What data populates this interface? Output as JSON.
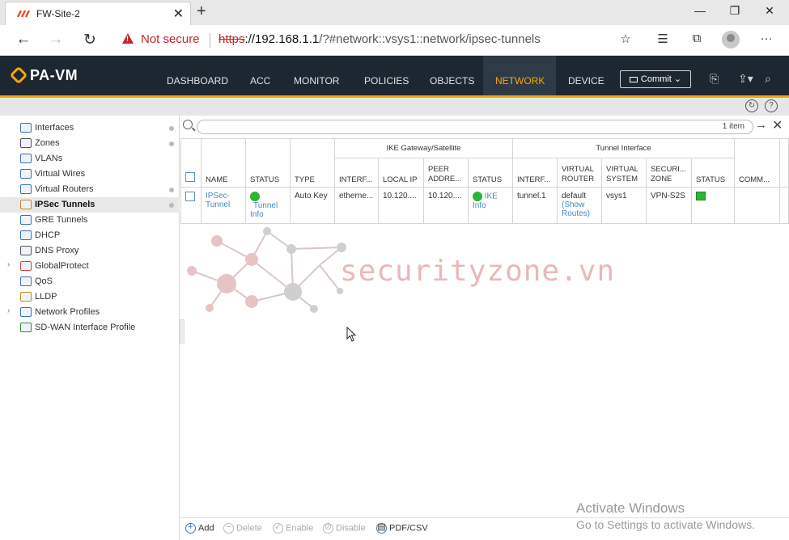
{
  "browser": {
    "tab_title": "FW-Site-2",
    "security_label": "Not secure",
    "url_scheme": "https",
    "url_host": "://192.168.1.1",
    "url_path": "/?#network::vsys1::network/ipsec-tunnels"
  },
  "app": {
    "brand": "PA-VM",
    "nav": [
      "DASHBOARD",
      "ACC",
      "MONITOR",
      "POLICIES",
      "OBJECTS",
      "NETWORK",
      "DEVICE"
    ],
    "active_nav": "NETWORK",
    "commit_label": "Commit"
  },
  "sidebar": {
    "items": [
      {
        "label": "Interfaces",
        "icon": "interfaces-icon",
        "dot": true
      },
      {
        "label": "Zones",
        "icon": "zones-icon",
        "dot": true
      },
      {
        "label": "VLANs",
        "icon": "vlans-icon",
        "dot": false
      },
      {
        "label": "Virtual Wires",
        "icon": "virtual-wires-icon",
        "dot": false
      },
      {
        "label": "Virtual Routers",
        "icon": "virtual-routers-icon",
        "dot": true
      },
      {
        "label": "IPSec Tunnels",
        "icon": "ipsec-tunnels-icon",
        "dot": true,
        "selected": true
      },
      {
        "label": "GRE Tunnels",
        "icon": "gre-tunnels-icon",
        "dot": false
      },
      {
        "label": "DHCP",
        "icon": "dhcp-icon",
        "dot": false
      },
      {
        "label": "DNS Proxy",
        "icon": "dns-proxy-icon",
        "dot": false
      },
      {
        "label": "GlobalProtect",
        "icon": "globalprotect-icon",
        "dot": false,
        "expandable": true
      },
      {
        "label": "QoS",
        "icon": "qos-icon",
        "dot": false
      },
      {
        "label": "LLDP",
        "icon": "lldp-icon",
        "dot": false
      },
      {
        "label": "Network Profiles",
        "icon": "network-profiles-icon",
        "dot": false,
        "expandable": true
      },
      {
        "label": "SD-WAN Interface Profile",
        "icon": "sdwan-icon",
        "dot": false
      }
    ]
  },
  "grid": {
    "item_count": "1 item",
    "group_headers": {
      "ike": "IKE Gateway/Satellite",
      "tunnel": "Tunnel Interface"
    },
    "columns": {
      "name": "NAME",
      "status": "STATUS",
      "type": "TYPE",
      "ike_interface": "INTERF...",
      "local_ip": "LOCAL IP",
      "peer_address": "PEER ADDRE...",
      "ike_status": "STATUS",
      "tun_interface": "INTERF...",
      "virtual_router": "VIRTUAL ROUTER",
      "virtual_system": "VIRTUAL SYSTEM",
      "security_zone": "SECURI... ZONE",
      "tun_status": "STATUS",
      "comment": "COMM..."
    },
    "rows": [
      {
        "name": "IPSec-Tunnel",
        "status_link": "Tunnel Info",
        "type": "Auto Key",
        "ike_interface": "etherne...",
        "local_ip": "10.120....",
        "peer_address": "10.120....",
        "ike_status_link": "IKE Info",
        "tun_interface": "tunnel.1",
        "virtual_router": "default",
        "virtual_router_link": "(Show Routes)",
        "virtual_system": "vsys1",
        "security_zone": "VPN-S2S",
        "comment": ""
      }
    ]
  },
  "footer": {
    "add": "Add",
    "delete": "Delete",
    "enable": "Enable",
    "disable": "Disable",
    "export": "PDF/CSV"
  },
  "watermark": {
    "brand": "securityzone.vn",
    "activate_title": "Activate Windows",
    "activate_sub": "Go to Settings to activate Windows."
  },
  "colors": {
    "accent": "#f5a800",
    "header_bg": "#1d2731",
    "status_ok": "#2bb534",
    "link": "#4a86c5"
  }
}
